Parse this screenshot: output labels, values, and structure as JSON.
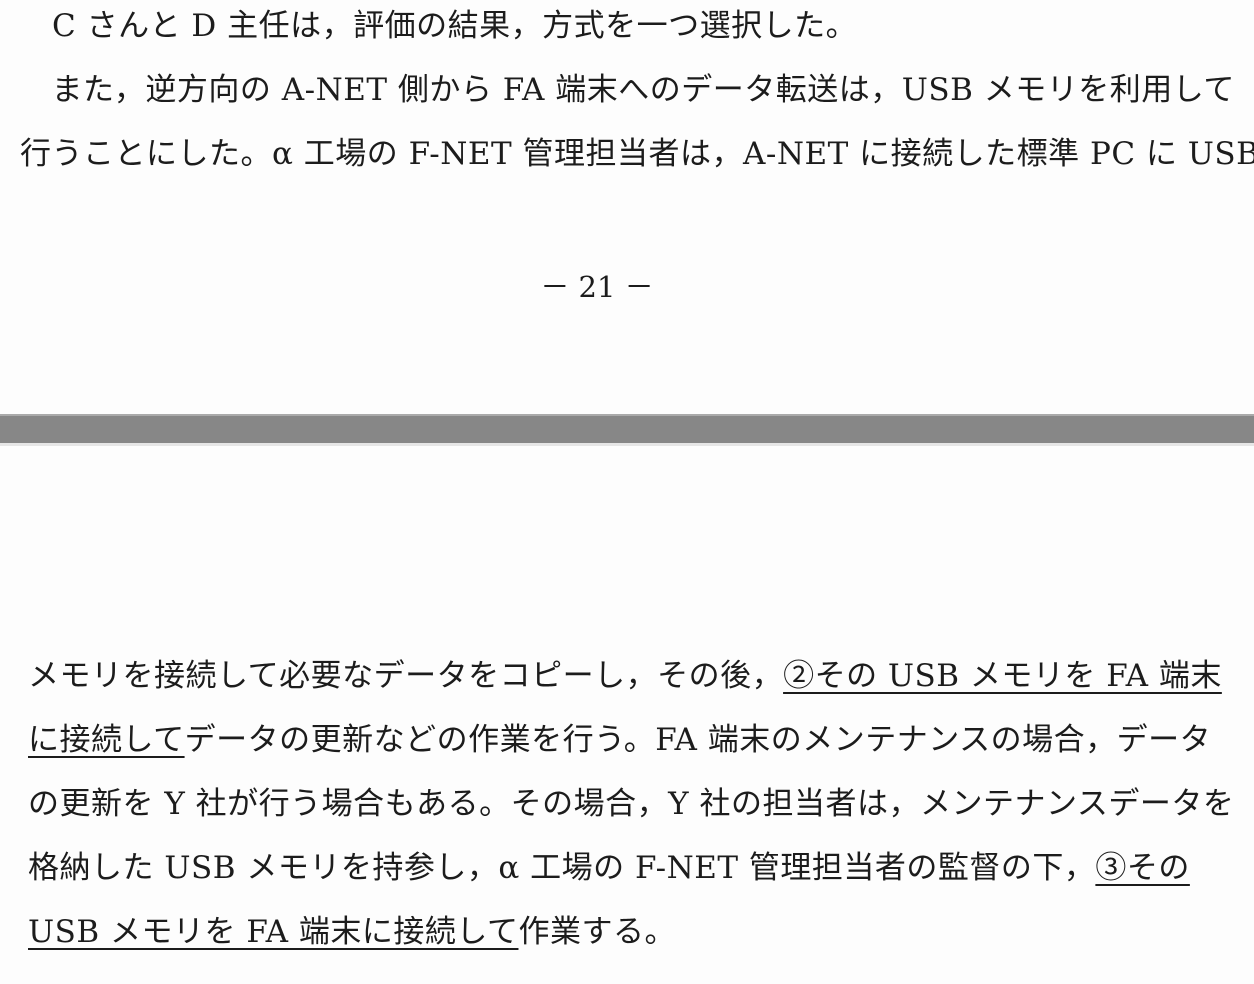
{
  "top_page": {
    "lines": [
      "C さんと D 主任は，評価の結果，方式を一つ選択した。",
      "　また，逆方向の A-NET 側から FA 端末へのデータ転送は，USB メモリを利用して",
      "行うことにした。α 工場の F-NET 管理担当者は，A-NET に接続した標準 PC に USB"
    ],
    "page_number": "－ 21 －"
  },
  "bottom_page": {
    "line1": {
      "plain": "メモリを接続して必要なデータをコピーし，その後，",
      "underlined": "②その USB メモリを FA 端末"
    },
    "line2": {
      "underlined": "に接続して",
      "plain": "データの更新などの作業を行う。FA 端末のメンテナンスの場合，データ"
    },
    "line3": "の更新を Y 社が行う場合もある。その場合，Y 社の担当者は，メンテナンスデータを",
    "line4": {
      "plain": "格納した USB メモリを持参し，α 工場の F-NET 管理担当者の監督の下，",
      "underlined": "③その"
    },
    "line5": {
      "underlined": "USB メモリを FA 端末に接続して",
      "plain": "作業する。"
    }
  }
}
